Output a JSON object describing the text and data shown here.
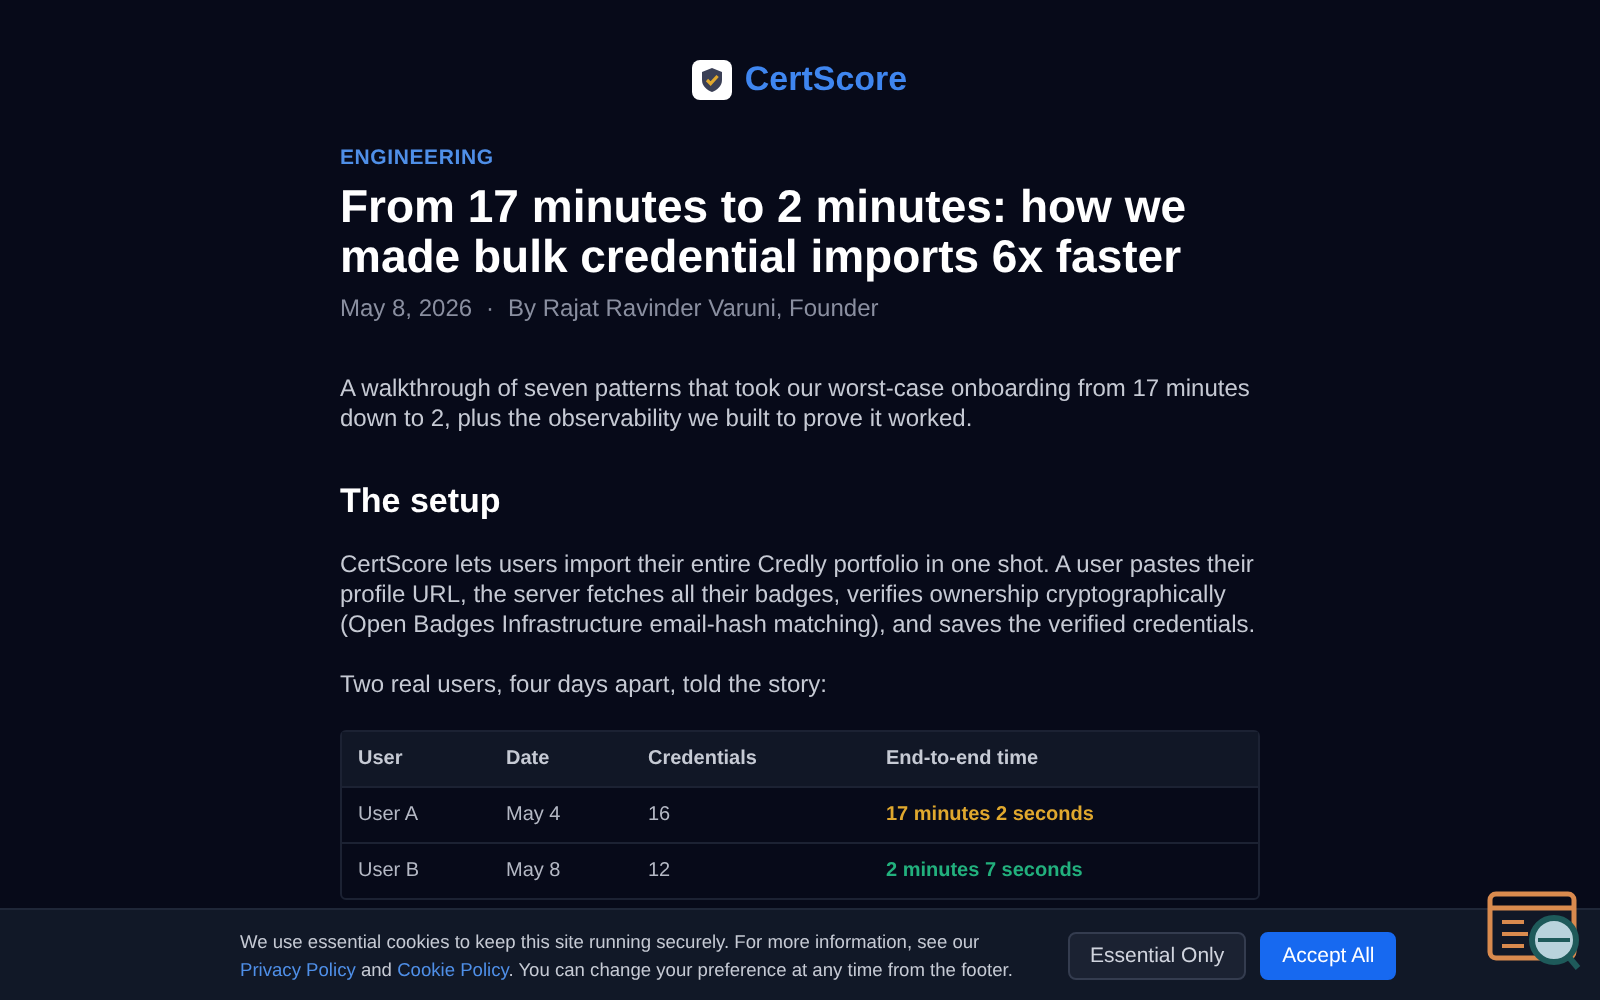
{
  "brand": {
    "name": "CertScore"
  },
  "article": {
    "category": "ENGINEERING",
    "title": "From 17 minutes to 2 minutes: how we made bulk credential imports 6x faster",
    "date": "May 8, 2026",
    "separator": "·",
    "byline": "By Rajat Ravinder Varuni, Founder",
    "lead": "A walkthrough of seven patterns that took our worst-case onboarding from 17 minutes down to 2, plus the observability we built to prove it worked.",
    "section_heading": "The setup",
    "paragraphs": [
      "CertScore lets users import their entire Credly portfolio in one shot. A user pastes their profile URL, the server fetches all their badges, verifies ownership cryptographically (Open Badges Infrastructure email-hash matching), and saves the verified credentials.",
      "Two real users, four days apart, told the story:"
    ],
    "table": {
      "columns": [
        "User",
        "Date",
        "Credentials",
        "End-to-end time"
      ],
      "rows": [
        {
          "cells": [
            "User A",
            "May 4",
            "16",
            "17 minutes 2 seconds"
          ],
          "color": "#e0a82e"
        },
        {
          "cells": [
            "User B",
            "May 8",
            "12",
            "2 minutes 7 seconds"
          ],
          "color": "#22b07d"
        }
      ]
    }
  },
  "cookie_banner": {
    "segments": [
      {
        "kind": "text",
        "text": "We use essential cookies to keep this site running securely. For more information, see our "
      },
      {
        "kind": "link",
        "text": "Privacy Policy"
      },
      {
        "kind": "text",
        "text": " and "
      },
      {
        "kind": "link",
        "text": "Cookie Policy"
      },
      {
        "kind": "text",
        "text": ". You can change your preference at any time from the footer."
      }
    ],
    "buttons": [
      {
        "label": "Essential Only",
        "kind": "secondary"
      },
      {
        "label": "Accept All",
        "kind": "primary"
      }
    ]
  }
}
